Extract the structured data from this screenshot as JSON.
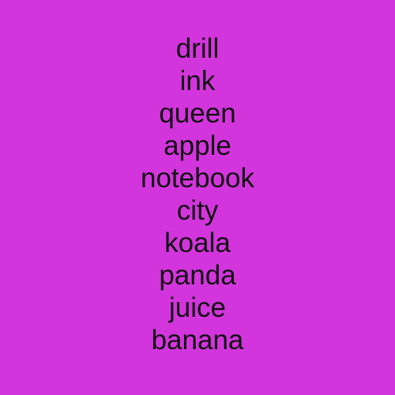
{
  "background_color": "#D335DD",
  "text_color": "#111111",
  "words": [
    "drill",
    "ink",
    "queen",
    "apple",
    "notebook",
    "city",
    "koala",
    "panda",
    "juice",
    "banana"
  ]
}
